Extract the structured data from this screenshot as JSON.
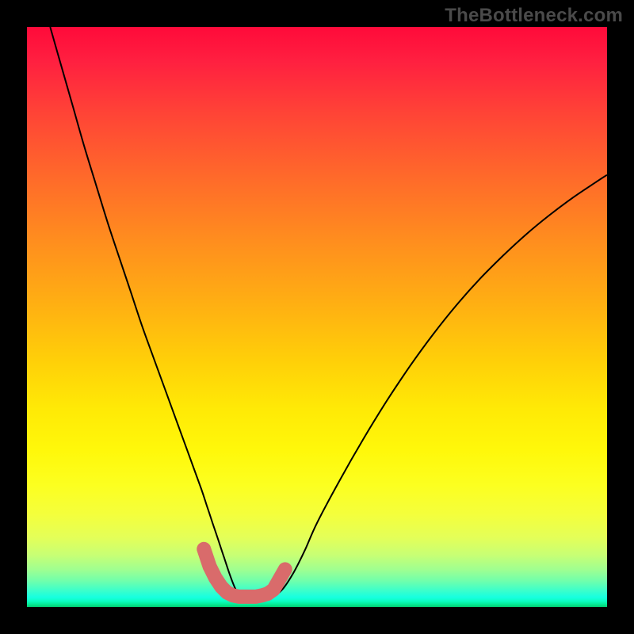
{
  "watermark": "TheBottleneck.com",
  "chart_data": {
    "type": "line",
    "title": "",
    "xlabel": "",
    "ylabel": "",
    "ylim": [
      0,
      100
    ],
    "xlim": [
      0,
      100
    ],
    "series": [
      {
        "name": "bottleneck-curve",
        "x": [
          4,
          6,
          8,
          10,
          12,
          14,
          16,
          18,
          20,
          22,
          24,
          26,
          28,
          30,
          31,
          32,
          33,
          34,
          35,
          36,
          37,
          38,
          40,
          42,
          44,
          46,
          48,
          50,
          54,
          58,
          62,
          66,
          70,
          74,
          78,
          82,
          86,
          90,
          94,
          98,
          100
        ],
        "values": [
          100,
          93,
          86,
          79,
          72.5,
          66,
          60,
          54,
          48,
          42.5,
          37,
          31.5,
          26,
          20.5,
          17.5,
          14.5,
          11.5,
          8.5,
          5.5,
          3,
          1.5,
          1,
          1,
          1.5,
          3,
          6,
          10,
          14.5,
          22,
          29,
          35.5,
          41.5,
          47,
          52,
          56.5,
          60.5,
          64.2,
          67.5,
          70.5,
          73.2,
          74.5
        ]
      }
    ],
    "markers": {
      "name": "highlight-band",
      "color": "#d96b6b",
      "x": [
        30.5,
        31.5,
        32.5,
        33.5,
        34.5,
        35.5,
        36.5,
        37.5,
        38.5,
        39.5,
        40.5,
        41.5,
        42.5,
        44.5
      ],
      "values": [
        10,
        7,
        5,
        3.5,
        2.5,
        2,
        1.8,
        1.8,
        1.8,
        1.8,
        2,
        2.3,
        3,
        6.5
      ]
    },
    "gradient_stops": [
      {
        "pos": 0,
        "color": "#ff0a3a"
      },
      {
        "pos": 0.5,
        "color": "#ffd108"
      },
      {
        "pos": 0.78,
        "color": "#fcff20"
      },
      {
        "pos": 1.0,
        "color": "#02c870"
      }
    ]
  }
}
